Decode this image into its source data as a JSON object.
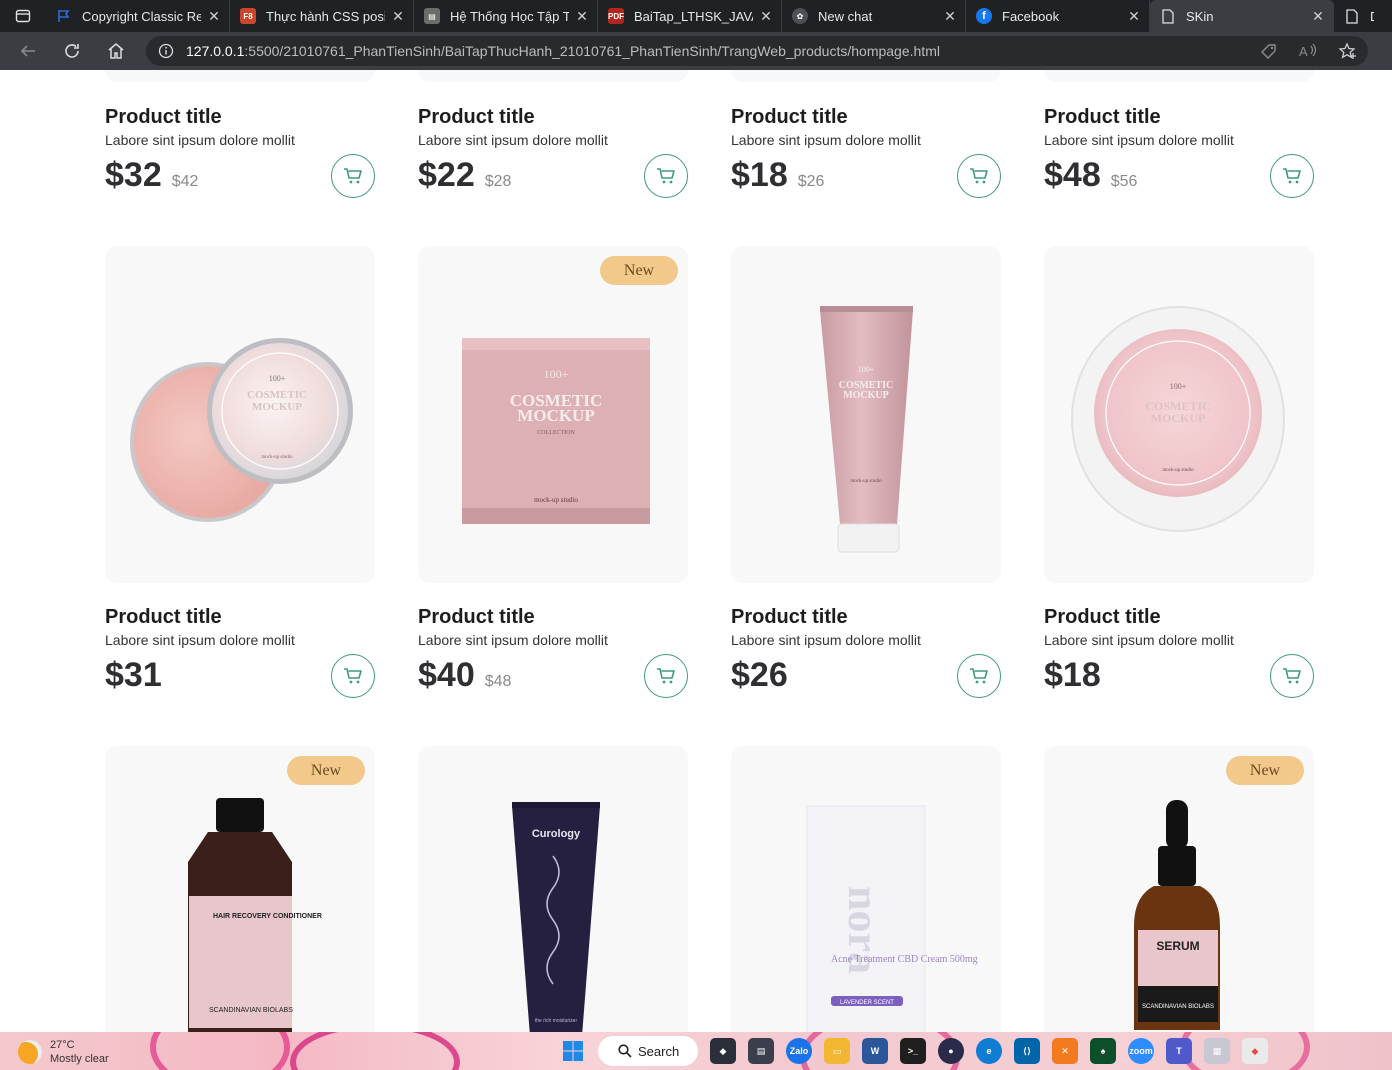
{
  "browser": {
    "tabs": [
      {
        "title": "Copyright Classic Regular",
        "icon": "flag-icon",
        "color": "#2b6cd8"
      },
      {
        "title": "Thực hành CSS position",
        "icon": "fb-doc-icon",
        "color": "#c9462c"
      },
      {
        "title": "Hệ Thống Học Tập Trực Tuyến",
        "icon": "school-icon",
        "color": "#6c6c6c"
      },
      {
        "title": "BaiTap_LTHSK_JAVA.pdf",
        "icon": "pdf-icon",
        "color": "#b3261e"
      },
      {
        "title": "New chat",
        "icon": "chatgpt-icon",
        "color": "#4d5156"
      },
      {
        "title": "Facebook",
        "icon": "facebook-icon",
        "color": "#1877f2"
      },
      {
        "title": "SKin",
        "icon": "page-icon",
        "color": "#cfcfcf",
        "active": true
      },
      {
        "title": "Do",
        "icon": "page-icon",
        "color": "#cfcfcf"
      }
    ],
    "address": {
      "host": "127.0.0.1",
      "path": ":5500/21010761_PhanTienSinh/BaiTapThucHanh_21010761_PhanTienSinh/TrangWeb_products/hompage.html"
    }
  },
  "products_top": [
    {
      "title": "Product title",
      "desc": "Labore sint ipsum dolore mollit",
      "price": "$32",
      "old": "$42"
    },
    {
      "title": "Product title",
      "desc": "Labore sint ipsum dolore mollit",
      "price": "$22",
      "old": "$28"
    },
    {
      "title": "Product title",
      "desc": "Labore sint ipsum dolore mollit",
      "price": "$18",
      "old": "$26"
    },
    {
      "title": "Product title",
      "desc": "Labore sint ipsum dolore mollit",
      "price": "$48",
      "old": "$56"
    }
  ],
  "products_mid": [
    {
      "title": "Product title",
      "desc": "Labore sint ipsum dolore mollit",
      "price": "$31",
      "old": "",
      "badge": "",
      "image": "round-tin-open-jar"
    },
    {
      "title": "Product title",
      "desc": "Labore sint ipsum dolore mollit",
      "price": "$40",
      "old": "$48",
      "badge": "New",
      "image": "pink-box"
    },
    {
      "title": "Product title",
      "desc": "Labore sint ipsum dolore mollit",
      "price": "$26",
      "old": "",
      "badge": "",
      "image": "pink-tube"
    },
    {
      "title": "Product title",
      "desc": "Labore sint ipsum dolore mollit",
      "price": "$18",
      "old": "",
      "badge": "",
      "image": "round-white-jar"
    }
  ],
  "products_bottom": [
    {
      "badge": "New",
      "image": "conditioner-bottle",
      "label_brand": "SCANDINAVIAN BIOLABS",
      "label_name": "HAIR RECOVERY CONDITIONER"
    },
    {
      "badge": "",
      "image": "curology-tube",
      "label_brand": "Curology",
      "label_name": "the rich moisturizer"
    },
    {
      "badge": "",
      "image": "nora-box",
      "label_brand": "nora",
      "label_name": "Acne Treatment CBD Cream 500mg",
      "label_extra": "LAVENDER SCENT"
    },
    {
      "badge": "New",
      "image": "serum-dropper",
      "label_brand": "SCANDINAVIAN BIOLABS",
      "label_name": "SERUM"
    }
  ],
  "mockup_text": {
    "line1": "100+",
    "line2": "COSMETIC",
    "line3": "MOCKUP",
    "line4": "COLLECTION",
    "studio": "mock-up studio"
  },
  "taskbar": {
    "temp": "27°C",
    "weather": "Mostly clear",
    "search": "Search"
  },
  "colors": {
    "accent": "#3f9a78",
    "badge": "#f2c98a",
    "card_bg": "#f8f8f8"
  }
}
